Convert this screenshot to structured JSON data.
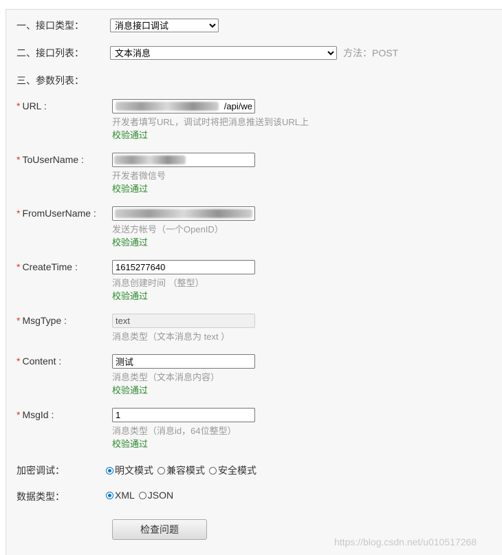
{
  "section1": {
    "label": "一、接口类型：",
    "select_value": "消息接口调试"
  },
  "section2": {
    "label": "二、接口列表：",
    "select_value": "文本消息",
    "method_text": "方法：POST"
  },
  "section3": {
    "label": "三、参数列表："
  },
  "fields": {
    "url": {
      "label": "URL :",
      "value_tail": "/api/we",
      "hint": "开发者填写URL，调试时将把消息推送到该URL上",
      "status": "校验通过"
    },
    "to_user": {
      "label": "ToUserName :",
      "hint": "开发者微信号",
      "status": "校验通过"
    },
    "from_user": {
      "label": "FromUserName :",
      "hint": "发送方帐号（一个OpenID）",
      "status": "校验通过"
    },
    "create_time": {
      "label": "CreateTime :",
      "value": "1615277640",
      "hint": "消息创建时间 （整型）",
      "status": "校验通过"
    },
    "msg_type": {
      "label": "MsgType :",
      "value": "text",
      "hint": "消息类型（文本消息为 text ）"
    },
    "content": {
      "label": "Content :",
      "value": "测试",
      "hint": "消息类型（文本消息内容）",
      "status": "校验通过"
    },
    "msg_id": {
      "label": "MsgId :",
      "value": "1",
      "hint": "消息类型（消息id，64位整型）",
      "status": "校验通过"
    }
  },
  "encryption": {
    "label": "加密调试：",
    "options": [
      "明文模式",
      "兼容模式",
      "安全模式"
    ],
    "selected": "明文模式"
  },
  "data_type": {
    "label": "数据类型：",
    "options": [
      "XML",
      "JSON"
    ],
    "selected": "XML"
  },
  "submit_label": "检查问题",
  "watermark": "https://blog.csdn.net/u010517268",
  "required_mark": "*",
  "colors": {
    "required": "#e63030",
    "valid": "#2a8a2a",
    "hint": "#999999",
    "radio_selected": "#0075d8"
  }
}
